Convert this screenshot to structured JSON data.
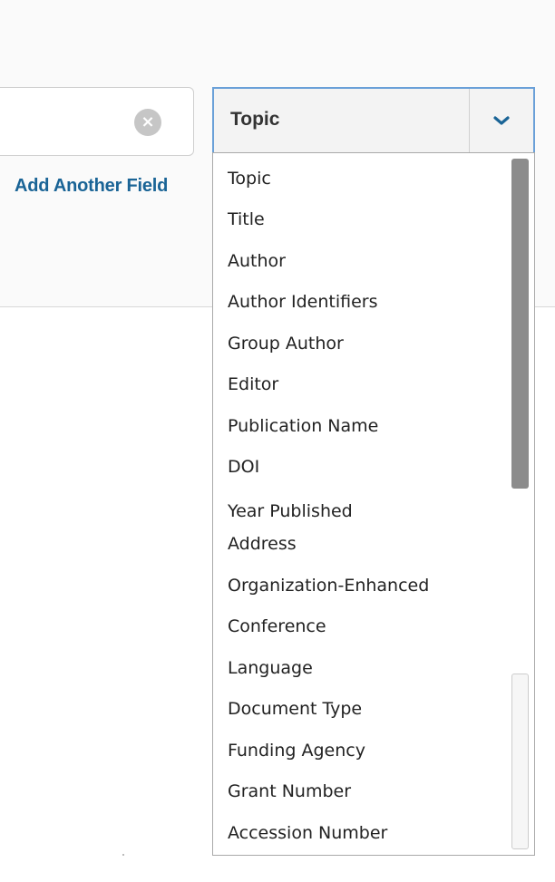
{
  "search": {
    "clear_glyph": "×"
  },
  "add_field": {
    "label": "Add Another Field"
  },
  "field_select": {
    "selected": "Topic",
    "options": [
      "Topic",
      "Title",
      "Author",
      "Author Identifiers",
      "Group Author",
      "Editor",
      "Publication Name",
      "DOI",
      "Year Published",
      "Address",
      "Organization-Enhanced",
      "Conference",
      "Language",
      "Document Type",
      "Funding Agency",
      "Grant Number",
      "Accession Number"
    ]
  },
  "colors": {
    "link": "#1a6496",
    "select_border": "#6aa0d8",
    "scroll_thumb": "#8c8c8c"
  }
}
